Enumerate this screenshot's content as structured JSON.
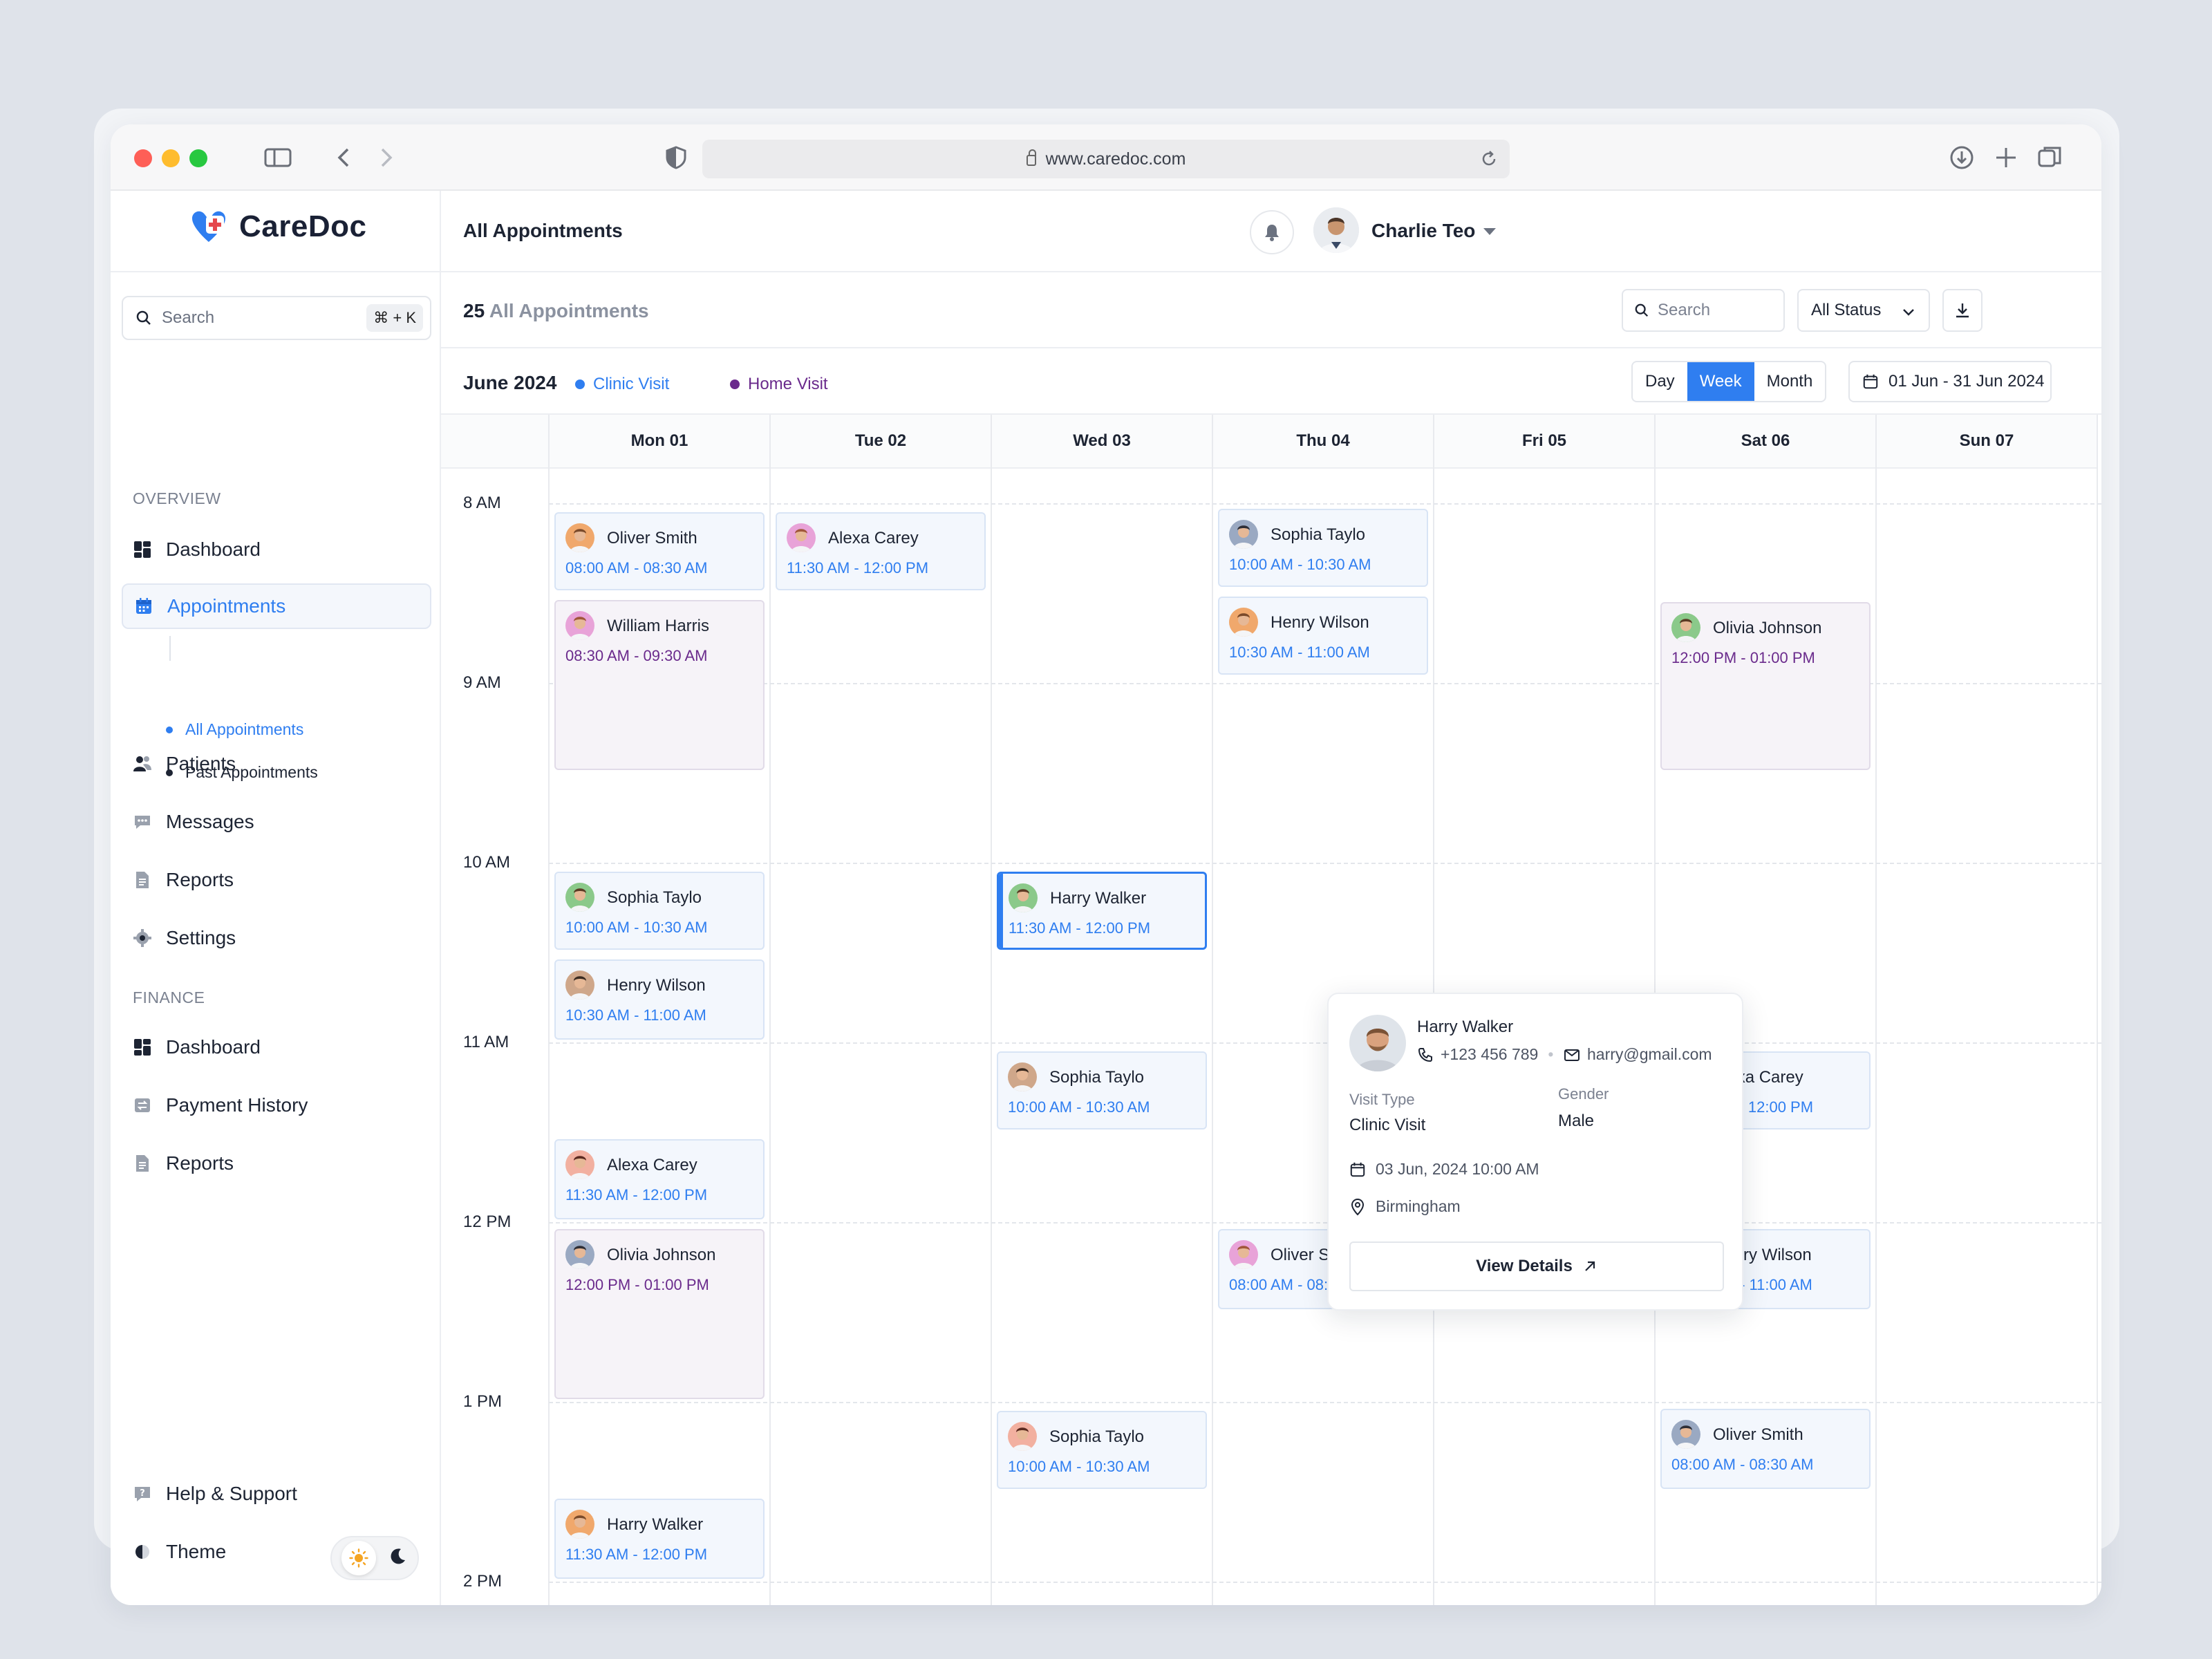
{
  "browser": {
    "url": "www.caredoc.com"
  },
  "brand": {
    "name": "CareDoc",
    "accent": "#2f7ef0",
    "home_color": "#6a2a8c"
  },
  "sidebar": {
    "search_placeholder": "Search",
    "shortcut": "⌘ + K",
    "overview_label": "OVERVIEW",
    "finance_label": "FINANCE",
    "items": [
      {
        "label": "Dashboard",
        "icon": "dashboard-icon"
      },
      {
        "label": "Appointments",
        "icon": "calendar-icon"
      },
      {
        "label": "Patients",
        "icon": "users-icon"
      },
      {
        "label": "Messages",
        "icon": "message-icon"
      },
      {
        "label": "Reports",
        "icon": "report-icon"
      },
      {
        "label": "Settings",
        "icon": "gear-icon"
      }
    ],
    "sub_items": [
      "All Appointments",
      "Past Appointments"
    ],
    "finance_items": [
      {
        "label": "Dashboard",
        "icon": "dashboard-icon"
      },
      {
        "label": "Payment History",
        "icon": "payment-icon"
      },
      {
        "label": "Reports",
        "icon": "report-icon"
      }
    ],
    "help": "Help & Support",
    "theme": "Theme"
  },
  "header": {
    "title": "All Appointments",
    "user": "Charlie Teo"
  },
  "toolbar": {
    "count": "25",
    "count_label": "All Appointments",
    "search_placeholder": "Search",
    "status": "All Status"
  },
  "calendar": {
    "month": "June 2024",
    "legend": [
      "Clinic Visit",
      "Home Visit"
    ],
    "views": [
      "Day",
      "Week",
      "Month"
    ],
    "active_view": "Week",
    "range": "01 Jun - 31 Jun 2024",
    "days": [
      "Mon 01",
      "Tue 02",
      "Wed 03",
      "Thu 04",
      "Fri 05",
      "Sat 06",
      "Sun 07"
    ],
    "hours": [
      "8 AM",
      "9 AM",
      "10 AM",
      "11 AM",
      "12 PM",
      "1 PM",
      "2 PM"
    ],
    "events": [
      {
        "day": 0,
        "start": 8.05,
        "end": 8.5,
        "name": "Oliver Smith",
        "time": "08:00 AM - 08:30 AM",
        "type": "clinic"
      },
      {
        "day": 0,
        "start": 8.54,
        "end": 9.5,
        "name": "William Harris",
        "time": "08:30 AM - 09:30 AM",
        "type": "home"
      },
      {
        "day": 0,
        "start": 10.05,
        "end": 10.5,
        "name": "Sophia Taylo",
        "time": "10:00 AM - 10:30 AM",
        "type": "clinic"
      },
      {
        "day": 0,
        "start": 10.54,
        "end": 11.0,
        "name": "Henry Wilson",
        "time": "10:30 AM - 11:00 AM",
        "type": "clinic"
      },
      {
        "day": 0,
        "start": 11.54,
        "end": 12.0,
        "name": "Alexa Carey",
        "time": "11:30 AM - 12:00 PM",
        "type": "clinic"
      },
      {
        "day": 0,
        "start": 12.04,
        "end": 13.0,
        "name": "Olivia Johnson",
        "time": "12:00 PM - 01:00 PM",
        "type": "home"
      },
      {
        "day": 0,
        "start": 13.54,
        "end": 14.0,
        "name": "Harry Walker",
        "time": "11:30 AM - 12:00 PM",
        "type": "clinic"
      },
      {
        "day": 1,
        "start": 8.05,
        "end": 8.5,
        "name": "Alexa Carey",
        "time": "11:30 AM - 12:00 PM",
        "type": "clinic"
      },
      {
        "day": 2,
        "start": 10.05,
        "end": 10.5,
        "name": "Harry Walker",
        "time": "11:30 AM - 12:00 PM",
        "type": "selected"
      },
      {
        "day": 2,
        "start": 11.05,
        "end": 11.5,
        "name": "Sophia Taylo",
        "time": "10:00 AM - 10:30 AM",
        "type": "clinic"
      },
      {
        "day": 2,
        "start": 13.05,
        "end": 13.5,
        "name": "Sophia Taylo",
        "time": "10:00 AM - 10:30 AM",
        "type": "clinic"
      },
      {
        "day": 3,
        "start": 8.03,
        "end": 8.48,
        "name": "Sophia Taylo",
        "time": "10:00 AM - 10:30 AM",
        "type": "clinic"
      },
      {
        "day": 3,
        "start": 8.52,
        "end": 8.97,
        "name": "Henry Wilson",
        "time": "10:30 AM - 11:00 AM",
        "type": "clinic"
      },
      {
        "day": 3,
        "start": 12.04,
        "end": 12.5,
        "name": "Oliver Smith",
        "time": "08:00 AM - 08:30 AM",
        "type": "clinic"
      },
      {
        "day": 5,
        "start": 8.55,
        "end": 9.5,
        "name": "Olivia Johnson",
        "time": "12:00 PM - 01:00 PM",
        "type": "home"
      },
      {
        "day": 5,
        "start": 11.05,
        "end": 11.5,
        "name": "Alexa Carey",
        "time": "11:30 AM - 12:00 PM",
        "type": "clinic"
      },
      {
        "day": 5,
        "start": 12.04,
        "end": 12.5,
        "name": "Henry Wilson",
        "time": "10:30 AM - 11:00 AM",
        "type": "clinic"
      },
      {
        "day": 5,
        "start": 13.04,
        "end": 13.5,
        "name": "Oliver Smith",
        "time": "08:00 AM - 08:30 AM",
        "type": "clinic"
      }
    ]
  },
  "popover": {
    "name": "Harry Walker",
    "phone": "+123 456 789",
    "email": "harry@gmail.com",
    "visit_type_label": "Visit Type",
    "visit_type": "Clinic Visit",
    "gender_label": "Gender",
    "gender": "Male",
    "datetime": "03 Jun, 2024 10:00 AM",
    "location": "Birmingham",
    "cta": "View Details"
  }
}
